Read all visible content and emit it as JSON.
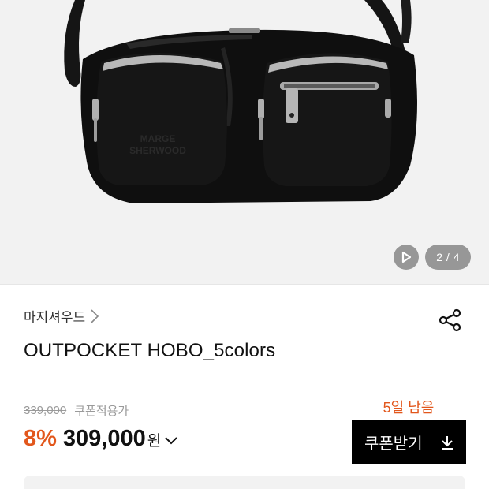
{
  "gallery": {
    "pager": "2 / 4",
    "image_description": "black leather hobo bag with two zip front pockets"
  },
  "product": {
    "brand": "마지셔우드",
    "title": "OUTPOCKET HOBO_5colors",
    "original_price": "339,000",
    "coupon_applied_label": "쿠폰적용가",
    "discount": "8%",
    "price": "309,000",
    "currency": "원"
  },
  "coupon": {
    "days_left": "5일 남음",
    "button_label": "쿠폰받기"
  },
  "colors": {
    "accent": "#e2571c",
    "button_bg": "#000000",
    "image_bg": "#f2f2f2"
  },
  "icons": {
    "play": "play-icon",
    "share": "share-icon",
    "brand_chevron": "chevron-right-icon",
    "price_chevron": "chevron-down-icon",
    "download": "download-icon"
  }
}
